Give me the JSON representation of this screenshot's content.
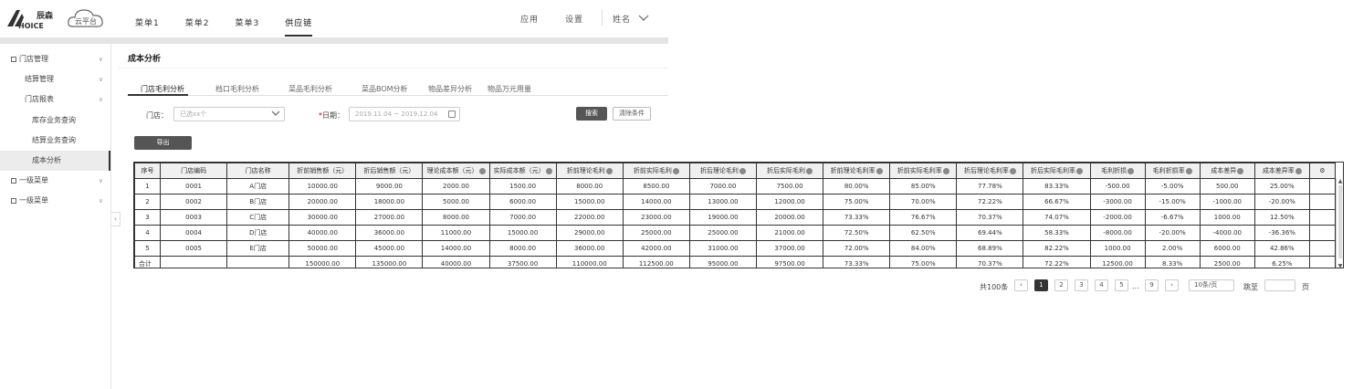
{
  "header": {
    "logo_text": "辰森",
    "logo_sub": "HOICE",
    "cloud_text": "云平台",
    "nav": [
      "菜单1",
      "菜单2",
      "菜单3",
      "供应链"
    ],
    "app": "应用",
    "settings": "设置",
    "user": "姓名"
  },
  "sidebar": {
    "items": [
      {
        "label": "门店管理"
      },
      {
        "label": "结算管理"
      },
      {
        "label": "门店报表"
      },
      {
        "label": "库存业务查询"
      },
      {
        "label": "结算业务查询"
      },
      {
        "label": "成本分析"
      },
      {
        "label": "一级菜单"
      },
      {
        "label": "一级菜单"
      }
    ]
  },
  "page_title": "成本分析",
  "tabs": [
    "门店毛利分析",
    "档口毛利分析",
    "菜品毛利分析",
    "菜品BOM分析",
    "物品差异分析",
    "物品万元用量"
  ],
  "filters": {
    "store_label": "门店：",
    "store_value": "已选xx个",
    "date_label": "日期：",
    "date_value": "2019.11.04 ~ 2019.12.04",
    "search": "搜索",
    "clear": "清除条件"
  },
  "export_label": "导出",
  "table": {
    "headers": [
      "序号",
      "门店编码",
      "门店名称",
      "折前销售额（元）",
      "折后销售额（元）",
      "理论成本额（元）",
      "实际成本额（元）",
      "折前理论毛利",
      "折前实际毛利",
      "折后理论毛利",
      "折后实际毛利",
      "折前理论毛利率",
      "折前实际毛利率",
      "折后理论毛利率",
      "折后实际毛利率",
      "毛利折损",
      "毛利折损率",
      "成本差异",
      "成本差异率"
    ],
    "rows": [
      [
        "1",
        "0001",
        "A门店",
        "10000.00",
        "9000.00",
        "2000.00",
        "1500.00",
        "8000.00",
        "8500.00",
        "7000.00",
        "7500.00",
        "80.00%",
        "85.00%",
        "77.78%",
        "83.33%",
        "-500.00",
        "-5.00%",
        "500.00",
        "25.00%"
      ],
      [
        "2",
        "0002",
        "B门店",
        "20000.00",
        "18000.00",
        "5000.00",
        "6000.00",
        "15000.00",
        "14000.00",
        "13000.00",
        "12000.00",
        "75.00%",
        "70.00%",
        "72.22%",
        "66.67%",
        "-3000.00",
        "-15.00%",
        "-1000.00",
        "-20.00%"
      ],
      [
        "3",
        "0003",
        "C门店",
        "30000.00",
        "27000.00",
        "8000.00",
        "7000.00",
        "22000.00",
        "23000.00",
        "19000.00",
        "20000.00",
        "73.33%",
        "76.67%",
        "70.37%",
        "74.07%",
        "-2000.00",
        "-6.67%",
        "1000.00",
        "12.50%"
      ],
      [
        "4",
        "0004",
        "D门店",
        "40000.00",
        "36000.00",
        "11000.00",
        "15000.00",
        "29000.00",
        "25000.00",
        "25000.00",
        "21000.00",
        "72.50%",
        "62.50%",
        "69.44%",
        "58.33%",
        "-8000.00",
        "-20.00%",
        "-4000.00",
        "-36.36%"
      ],
      [
        "5",
        "0005",
        "E门店",
        "50000.00",
        "45000.00",
        "14000.00",
        "8000.00",
        "36000.00",
        "42000.00",
        "31000.00",
        "37000.00",
        "72.00%",
        "84.00%",
        "68.89%",
        "82.22%",
        "1000.00",
        "2.00%",
        "6000.00",
        "42.86%"
      ],
      [
        "合计",
        "",
        "",
        "150000.00",
        "135000.00",
        "40000.00",
        "37500.00",
        "110000.00",
        "112500.00",
        "95000.00",
        "97500.00",
        "73.33%",
        "75.00%",
        "70.37%",
        "72.22%",
        "12500.00",
        "8.33%",
        "2500.00",
        "6.25%"
      ]
    ]
  },
  "pagination": {
    "total": "共100条",
    "pages": [
      "1",
      "2",
      "3",
      "4",
      "5",
      "...",
      "9"
    ],
    "page_size": "10条/页",
    "goto_label": "跳至",
    "goto_suffix": "页"
  }
}
